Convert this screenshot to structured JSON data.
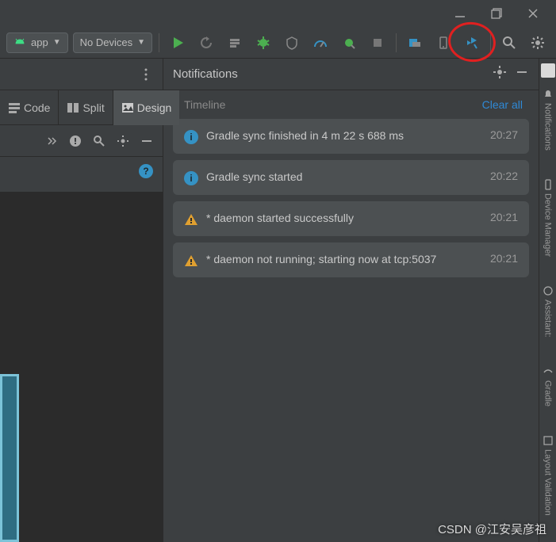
{
  "toolbar": {
    "app_label": "app",
    "device_label": "No Devices"
  },
  "view_tabs": {
    "code": "Code",
    "split": "Split",
    "design": "Design"
  },
  "notifications": {
    "title": "Notifications",
    "timeline_label": "Timeline",
    "clear_all_label": "Clear all",
    "items": [
      {
        "kind": "info",
        "message": "Gradle sync finished in 4 m 22 s 688 ms",
        "time": "20:27"
      },
      {
        "kind": "info",
        "message": "Gradle sync started",
        "time": "20:22"
      },
      {
        "kind": "warn",
        "message": "* daemon started successfully",
        "time": "20:21"
      },
      {
        "kind": "warn",
        "message": "* daemon not running; starting now at tcp:5037",
        "time": "20:21"
      }
    ]
  },
  "right_tabs": {
    "notifications": "Notifications",
    "device_manager": "Device Manager",
    "assistant": "Assistant:",
    "gradle": "Gradle",
    "layout_validation": "Layout Validation"
  },
  "watermark": "CSDN @江安吴彦祖"
}
